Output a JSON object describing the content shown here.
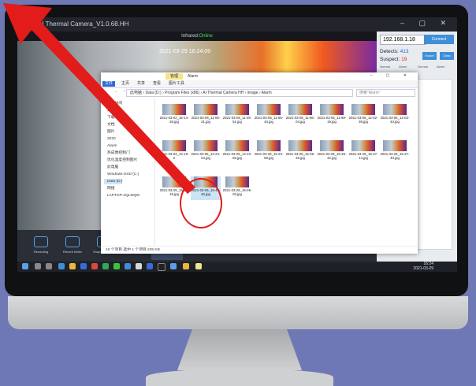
{
  "app": {
    "title": "AI Thermal Camera_V1.0.68.HH",
    "window_controls": "– ▢ ✕"
  },
  "status": {
    "prefix": "Infrared:",
    "state": "Online"
  },
  "camera": {
    "timestamp": "2021-03-29 16:24:09"
  },
  "panel": {
    "ip": "192.168.1.18",
    "connect_label": "Connect",
    "detects_label": "Detects:",
    "detects": "413",
    "suspect_label": "Suspect:",
    "suspect": "19",
    "export_label": "Export",
    "clear_label": "Clear",
    "check_labels": [
      "Normal",
      "Alarm",
      "Normal",
      "Alarm"
    ]
  },
  "toolbar": {
    "items": [
      "Recording",
      "Record folder",
      "Snapshot folder",
      "Setting",
      "Face alarm"
    ]
  },
  "explorer": {
    "title": "Alarm",
    "manage": "管理",
    "tabs": [
      "文件",
      "主页",
      "共享",
      "查看",
      "图片工具"
    ],
    "path": "此电脑 › Data (D:) › Program Files (x86) › AI Thermal Camera HH › image › Alarm",
    "search_placeholder": "搜索\"Alarm\"",
    "nav": [
      "快速访问",
      "桌面",
      "下载",
      "文档",
      "图片",
      "2020",
      "Alarm",
      "热成像控制门",
      "优化温度控制图片",
      "此电脑",
      "Windows-SSD (C:)",
      "Data (D:)",
      "网络",
      "LAPTOP-2QLMQ6I"
    ],
    "files": [
      "2021-03-02_16-14-25.jpg",
      "2021-03-05_11-05-21.jpg",
      "2021-03-05_11-25-51.jpg",
      "2021-03-05_11-55-43.jpg",
      "2021-03-05_11-56-04.jpg",
      "2021-03-05_11-59-19.jpg",
      "2021-03-05_12-02-39.jpg",
      "2021-03-05_12-02-43.jpg",
      "2021-03-03_12-19-2",
      "2021-03-05_12-24-04.jpg",
      "2021-03-29_14-10-56.jpg",
      "2021-03-29_15-22-58.jpg",
      "2021-03-29_15-36-32.jpg",
      "2021-03-29_15-36-42.jpg",
      "2021-03-29_15-37-14.jpg",
      "2021-03-29_15-37-40.jpg",
      "2021-03-29_15-38-18.jpg",
      "2021-03-29_15-40-46.jpg",
      "2021-03-29_16-05-03.jpg"
    ],
    "status": "19 个项目    选中 1 个项目  205 KB"
  },
  "taskbar": {
    "time": "16:24",
    "date": "2021-03-29"
  },
  "colors": {
    "annotation_red": "#e21b1b",
    "accent_blue": "#3f8ed8",
    "online_green": "#4de04d"
  }
}
